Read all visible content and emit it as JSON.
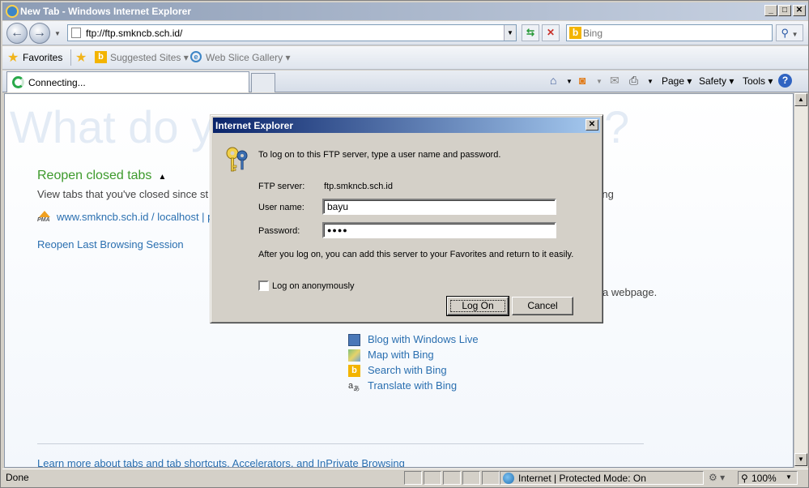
{
  "window": {
    "title": "New Tab - Windows Internet Explorer",
    "minimize": "_",
    "maximize": "□",
    "close": "✕"
  },
  "addressbar": {
    "url": "ftp://ftp.smkncb.sch.id/",
    "search_placeholder": "Bing"
  },
  "favorites_bar": {
    "favorites_label": "Favorites",
    "items": [
      {
        "label": "Suggested Sites ▾"
      },
      {
        "label": "Web Slice Gallery ▾"
      }
    ]
  },
  "tabs": {
    "active_label": "Connecting..."
  },
  "command_bar": {
    "page": "Page ▾",
    "safety": "Safety ▾",
    "tools": "Tools ▾",
    "help": "?"
  },
  "content": {
    "background_heading": "What do y",
    "background_heading_end": "?",
    "reopen_heading": "Reopen closed tabs",
    "reopen_caret": "▲",
    "reopen_desc": "View tabs that you've closed since st",
    "reopen_desc_end": "sing",
    "closed_tab_icon_label": "PMA",
    "closed_tab": "www.smkncb.sch.id / localhost | p",
    "reopen_last": "Reopen Last Browsing Session",
    "webpage_text": "a webpage.",
    "accelerators": [
      {
        "label": "Blog with Windows Live",
        "icon": "blog-icon"
      },
      {
        "label": "Map with Bing",
        "icon": "map-icon"
      },
      {
        "label": "Search with Bing",
        "icon": "bing-icon"
      },
      {
        "label": "Translate with Bing",
        "icon": "translate-icon"
      }
    ],
    "learn_more": "Learn more about tabs and tab shortcuts, Accelerators, and InPrivate Browsing"
  },
  "statusbar": {
    "done": "Done",
    "zone": "Internet | Protected Mode: On",
    "zoom": "100%"
  },
  "dialog": {
    "title": "Internet Explorer",
    "intro": "To log on to this FTP server, type a user name and password.",
    "ftp_server_label": "FTP server:",
    "ftp_server_value": "ftp.smkncb.sch.id",
    "username_label": "User name:",
    "username_value": "bayu",
    "password_label": "Password:",
    "password_value": "●●●●",
    "after_text": "After you log on, you can add this server to your Favorites and return to it easily.",
    "anonymous_label": "Log on anonymously",
    "anonymous_checked": false,
    "logon_button": "Log On",
    "cancel_button": "Cancel"
  },
  "colors": {
    "link": "#2a6fb0",
    "heading_green": "#3d9a2c",
    "dialog_title": "#0a246a"
  }
}
